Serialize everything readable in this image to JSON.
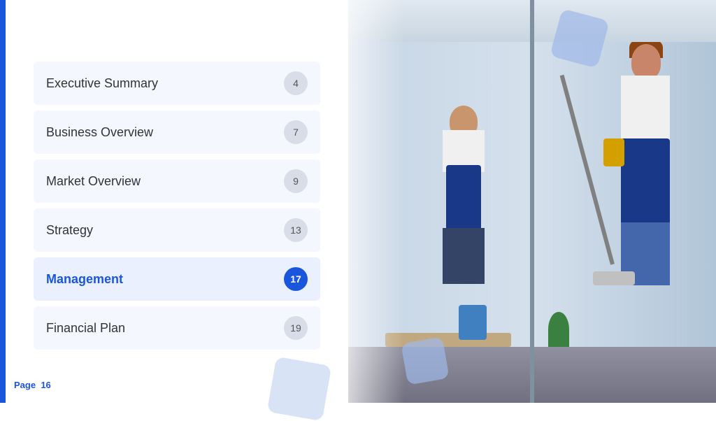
{
  "slide": {
    "page_label": "Page",
    "page_number": "16"
  },
  "toc": {
    "items": [
      {
        "id": "executive-summary",
        "label": "Executive Summary",
        "page": "4",
        "active": false
      },
      {
        "id": "business-overview",
        "label": "Business Overview",
        "page": "7",
        "active": false
      },
      {
        "id": "market-overview",
        "label": "Market Overview",
        "page": "9",
        "active": false
      },
      {
        "id": "strategy",
        "label": "Strategy",
        "page": "13",
        "active": false
      },
      {
        "id": "management",
        "label": "Management",
        "page": "17",
        "active": true
      },
      {
        "id": "financial-plan",
        "label": "Financial Plan",
        "page": "19",
        "active": false
      }
    ]
  },
  "colors": {
    "accent": "#1a56db",
    "active_bg": "#ebf0ff",
    "inactive_bg": "#f5f7ff",
    "active_page_badge": "#1a56db",
    "inactive_page_badge": "#d8dde8",
    "left_bar": "#1a56db"
  }
}
